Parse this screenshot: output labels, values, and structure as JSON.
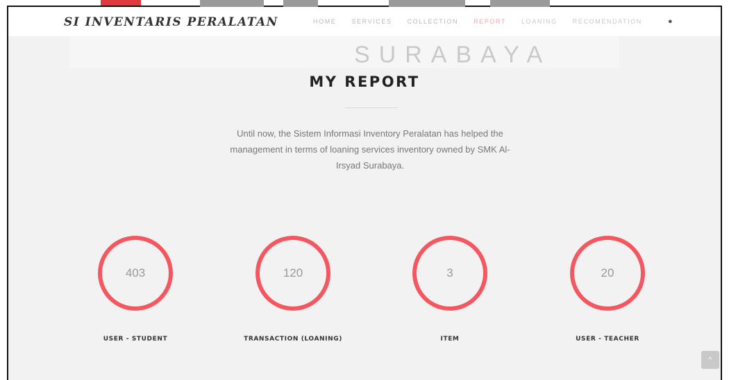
{
  "watermark": {
    "text": "SURABAYA"
  },
  "header": {
    "brand": "SI INVENTARIS PERALATAN",
    "nav": [
      {
        "label": "HOME",
        "state": "normal"
      },
      {
        "label": "SERVICES",
        "state": "normal"
      },
      {
        "label": "COLLECTION",
        "state": "normal"
      },
      {
        "label": "REPORT",
        "state": "active"
      },
      {
        "label": "LOANING",
        "state": "normal"
      },
      {
        "label": "RECOMENDATION",
        "state": "normal"
      }
    ],
    "extra_icon": "user-icon"
  },
  "main": {
    "title": "MY REPORT",
    "description": "Until now, the Sistem Informasi Inventory Peralatan has helped the management in terms of loaning services inventory owned by SMK Al-Irsyad Surabaya.",
    "stats": [
      {
        "value": "403",
        "label": "USER - STUDENT"
      },
      {
        "value": "120",
        "label": "TRANSACTION (LOANING)"
      },
      {
        "value": "3",
        "label": "ITEM"
      },
      {
        "value": "20",
        "label": "USER - TEACHER"
      }
    ]
  },
  "scroll_top": {
    "icon": "chevron-up-icon",
    "glyph": "^"
  },
  "colors": {
    "accent": "#f45760",
    "active_nav": "#f3a7a9",
    "background": "#f2f2f2"
  }
}
